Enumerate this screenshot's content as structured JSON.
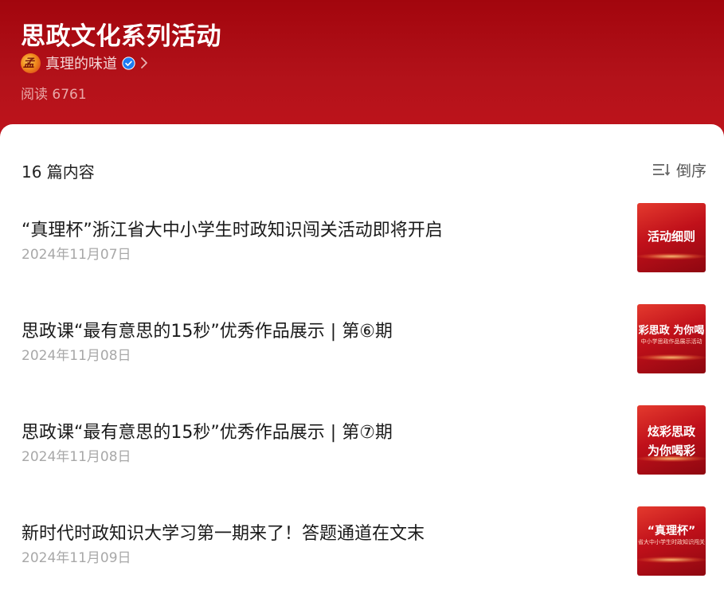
{
  "header": {
    "album_title": "思政文化系列活动",
    "author_name": "真理的味道",
    "read_count": "阅读 6761"
  },
  "list": {
    "count_label": "16 篇内容",
    "sort_label": "倒序",
    "articles": [
      {
        "title": "“真理杯”浙江省大中小学生时政知识闯关活动即将开启",
        "date": "2024年11月07日",
        "thumb_text": "活动细则",
        "thumb_sub": ""
      },
      {
        "title": "思政课“最有意思的15秒”优秀作品展示 | 第⑥期",
        "date": "2024年11月08日",
        "thumb_text": "彩思政 为你喝",
        "thumb_sub": "中小学思政作品展示活动"
      },
      {
        "title": "思政课“最有意思的15秒”优秀作品展示 | 第⑦期",
        "date": "2024年11月08日",
        "thumb_text": "炫彩思政",
        "thumb_text2": "为你喝彩"
      },
      {
        "title": "新时代时政知识大学习第一期来了！答题通道在文末",
        "date": "2024年11月09日",
        "thumb_text": "“真理杯”",
        "thumb_sub": "省大中小学生时政知识闯关"
      }
    ]
  },
  "colors": {
    "header_red": "#b3121a",
    "verified_blue": "#1e7cf2"
  },
  "icons": [
    "avatar-logo",
    "verified-badge-icon",
    "chevron-right-icon",
    "sort-order-icon"
  ]
}
